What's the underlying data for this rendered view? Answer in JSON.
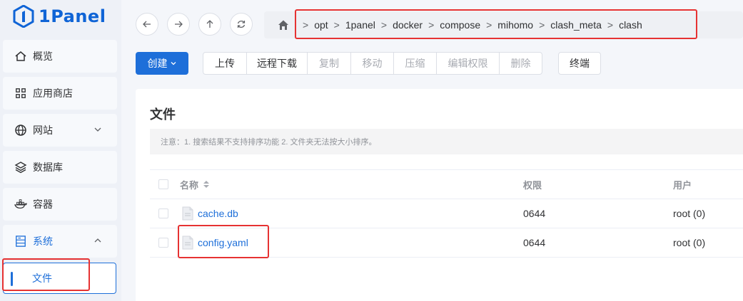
{
  "logo": {
    "text": "1Panel"
  },
  "sidebar": {
    "items": [
      {
        "label": "概览",
        "icon": "home-icon"
      },
      {
        "label": "应用商店",
        "icon": "grid-icon"
      },
      {
        "label": "网站",
        "icon": "globe-icon",
        "expandable": true
      },
      {
        "label": "数据库",
        "icon": "layers-icon"
      },
      {
        "label": "容器",
        "icon": "docker-icon"
      },
      {
        "label": "系统",
        "icon": "server-icon",
        "expanded": true
      }
    ],
    "sub_active": "文件"
  },
  "breadcrumb": [
    "opt",
    "1panel",
    "docker",
    "compose",
    "mihomo",
    "clash_meta",
    "clash"
  ],
  "toolbar": {
    "create": "创建",
    "upload": "上传",
    "remote_download": "远程下载",
    "copy": "复制",
    "move": "移动",
    "compress": "压缩",
    "edit_permission": "编辑权限",
    "delete": "删除",
    "terminal": "终端"
  },
  "main": {
    "title": "文件",
    "notice": "注意：1. 搜索结果不支持排序功能 2. 文件夹无法按大小排序。",
    "columns": {
      "name": "名称",
      "permission": "权限",
      "user": "用户"
    },
    "rows": [
      {
        "name": "cache.db",
        "permission": "0644",
        "user": "root (0)"
      },
      {
        "name": "config.yaml",
        "permission": "0644",
        "user": "root (0)"
      }
    ]
  },
  "colors": {
    "primary": "#1e6fd9",
    "annotation": "#e63232"
  }
}
